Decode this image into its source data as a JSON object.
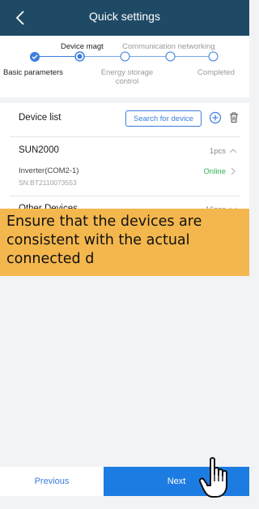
{
  "header": {
    "title": "Quick settings"
  },
  "steps": [
    {
      "label": "Basic parameters",
      "state": "done"
    },
    {
      "label": "Device magt",
      "state": "active"
    },
    {
      "label": "Energy storage control",
      "state": "pending"
    },
    {
      "label": "Communication networking",
      "state": "pending"
    },
    {
      "label": "Completed",
      "state": "pending"
    }
  ],
  "device_list": {
    "title": "Device list",
    "search_label": "Search for device",
    "add_icon": "add-circle-icon",
    "delete_icon": "trash-icon"
  },
  "groups": [
    {
      "name": "SUN2000",
      "count": "1pcs",
      "expanded": true
    },
    {
      "name": "Other Devices",
      "count": "16pcs",
      "expanded": false
    }
  ],
  "device": {
    "name": "Inverter(COM2-1)",
    "sn": "SN:BT2110073553",
    "status": "Online",
    "status_color": "#2bb24c"
  },
  "tooltip": {
    "text": "Ensure that the devices are consistent with the actual connected d"
  },
  "footer": {
    "previous": "Previous",
    "next": "Next"
  },
  "colors": {
    "header_bg": "#1f4a66",
    "accent": "#3b7ddd",
    "next_bg": "#1d7ce2",
    "tooltip_bg": "#f3b74d"
  }
}
